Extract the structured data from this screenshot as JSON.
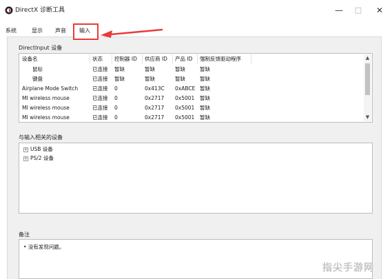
{
  "window": {
    "title": "DirectX 诊断工具",
    "minimize": "—",
    "maximize": "□",
    "close": "✕"
  },
  "tabs": [
    {
      "label": "系统"
    },
    {
      "label": "显示"
    },
    {
      "label": "声音"
    },
    {
      "label": "输入",
      "active": true
    }
  ],
  "directinput": {
    "group_label": "DirectInput 设备",
    "columns": [
      "设备名",
      "状态",
      "控制器 ID",
      "供应商 ID",
      "产品 ID",
      "强制反馈驱动程序"
    ],
    "rows": [
      [
        "鼠标",
        "已连接",
        "暂缺",
        "暂缺",
        "暂缺",
        "暂缺"
      ],
      [
        "键盘",
        "已连接",
        "暂缺",
        "暂缺",
        "暂缺",
        "暂缺"
      ],
      [
        "Airplane Mode Switch",
        "已连接",
        "0",
        "0x413C",
        "0xABCE",
        "暂缺"
      ],
      [
        "MI wireless mouse",
        "已连接",
        "0",
        "0x2717",
        "0x5001",
        "暂缺"
      ],
      [
        "MI wireless mouse",
        "已连接",
        "0",
        "0x2717",
        "0x5001",
        "暂缺"
      ],
      [
        "MI wireless mouse",
        "已连接",
        "0",
        "0x2717",
        "0x5001",
        "暂缺"
      ]
    ]
  },
  "related": {
    "group_label": "与输入相关的设备",
    "items": [
      {
        "label": "USB 设备",
        "expander": "+"
      },
      {
        "label": "PS/2 设备",
        "expander": "+"
      }
    ]
  },
  "notes": {
    "group_label": "备注",
    "lines": [
      "没有发现问题。"
    ]
  },
  "watermark": "指尖手游网",
  "colors": {
    "highlight_box": "#e83b3b",
    "panel_bg": "#f0f0f0"
  }
}
